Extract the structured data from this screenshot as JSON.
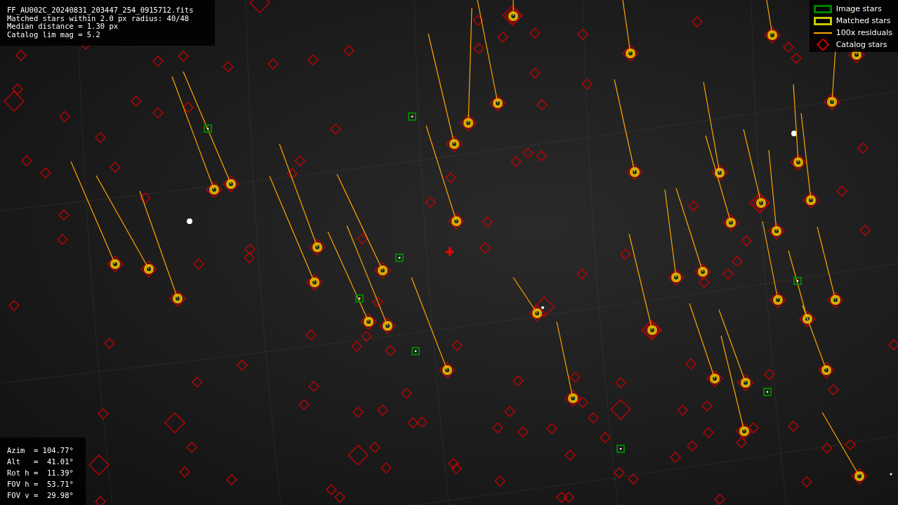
{
  "file_info": {
    "lines": [
      "FF_AU002C_20240831_203447_254_0915712.fits",
      "Matched stars within 2.0 px radius: 40/48",
      "Median distance = 1.30 px",
      "Catalog lim mag = 5.2"
    ]
  },
  "legend": [
    {
      "kind": "image",
      "label": "Image stars",
      "color": "#008000"
    },
    {
      "kind": "matched",
      "label": "Matched stars",
      "color": "#c8c800"
    },
    {
      "kind": "residual",
      "label": "100x residuals",
      "color": "#ffa500"
    },
    {
      "kind": "catalog",
      "label": "Catalog stars",
      "color": "#c80000"
    }
  ],
  "pointing": {
    "lines": [
      "Azim  = 104.77°",
      "Alt   =  41.01°",
      "Rot h =  11.39°",
      "FOV h =  53.71°",
      "FOV v =  29.98°"
    ]
  }
}
